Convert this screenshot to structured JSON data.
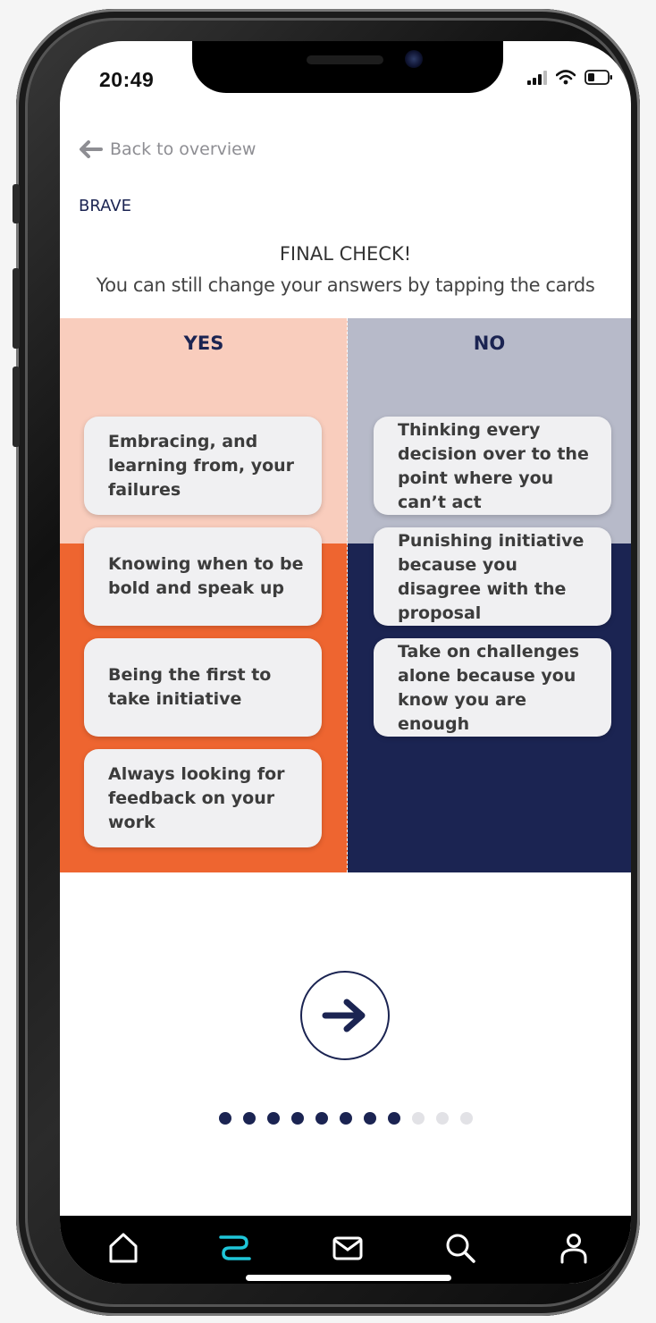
{
  "status_bar": {
    "time": "20:49"
  },
  "nav": {
    "back_label": "Back to overview"
  },
  "category": "BRAVE",
  "header": {
    "title": "FINAL CHECK!",
    "subtitle": "You can still change your answers by tapping the cards"
  },
  "columns": {
    "yes": {
      "label": "YES",
      "cards": [
        "Embracing, and learning from, your failures",
        "Knowing when to be bold and speak up",
        "Being the first to take initiative",
        "Always looking for feedback on your work"
      ]
    },
    "no": {
      "label": "NO",
      "cards": [
        "Thinking every decision over to the point where you can’t act",
        "Punishing initiative because you disagree with the proposal",
        "Take on challenges alone because you know you are enough"
      ]
    }
  },
  "progress": {
    "current": 8,
    "total": 11
  },
  "tabs": [
    {
      "icon": "home-icon"
    },
    {
      "icon": "journey-icon",
      "active": true
    },
    {
      "icon": "mail-icon"
    },
    {
      "icon": "search-icon"
    },
    {
      "icon": "profile-icon"
    }
  ],
  "colors": {
    "navy": "#1b2452",
    "orange": "#ee6530",
    "peach": "#f9cdbd",
    "grey_blue": "#b7bac9",
    "active_tab": "#1fc6d9",
    "dot_inactive": "#e2e2e6"
  }
}
